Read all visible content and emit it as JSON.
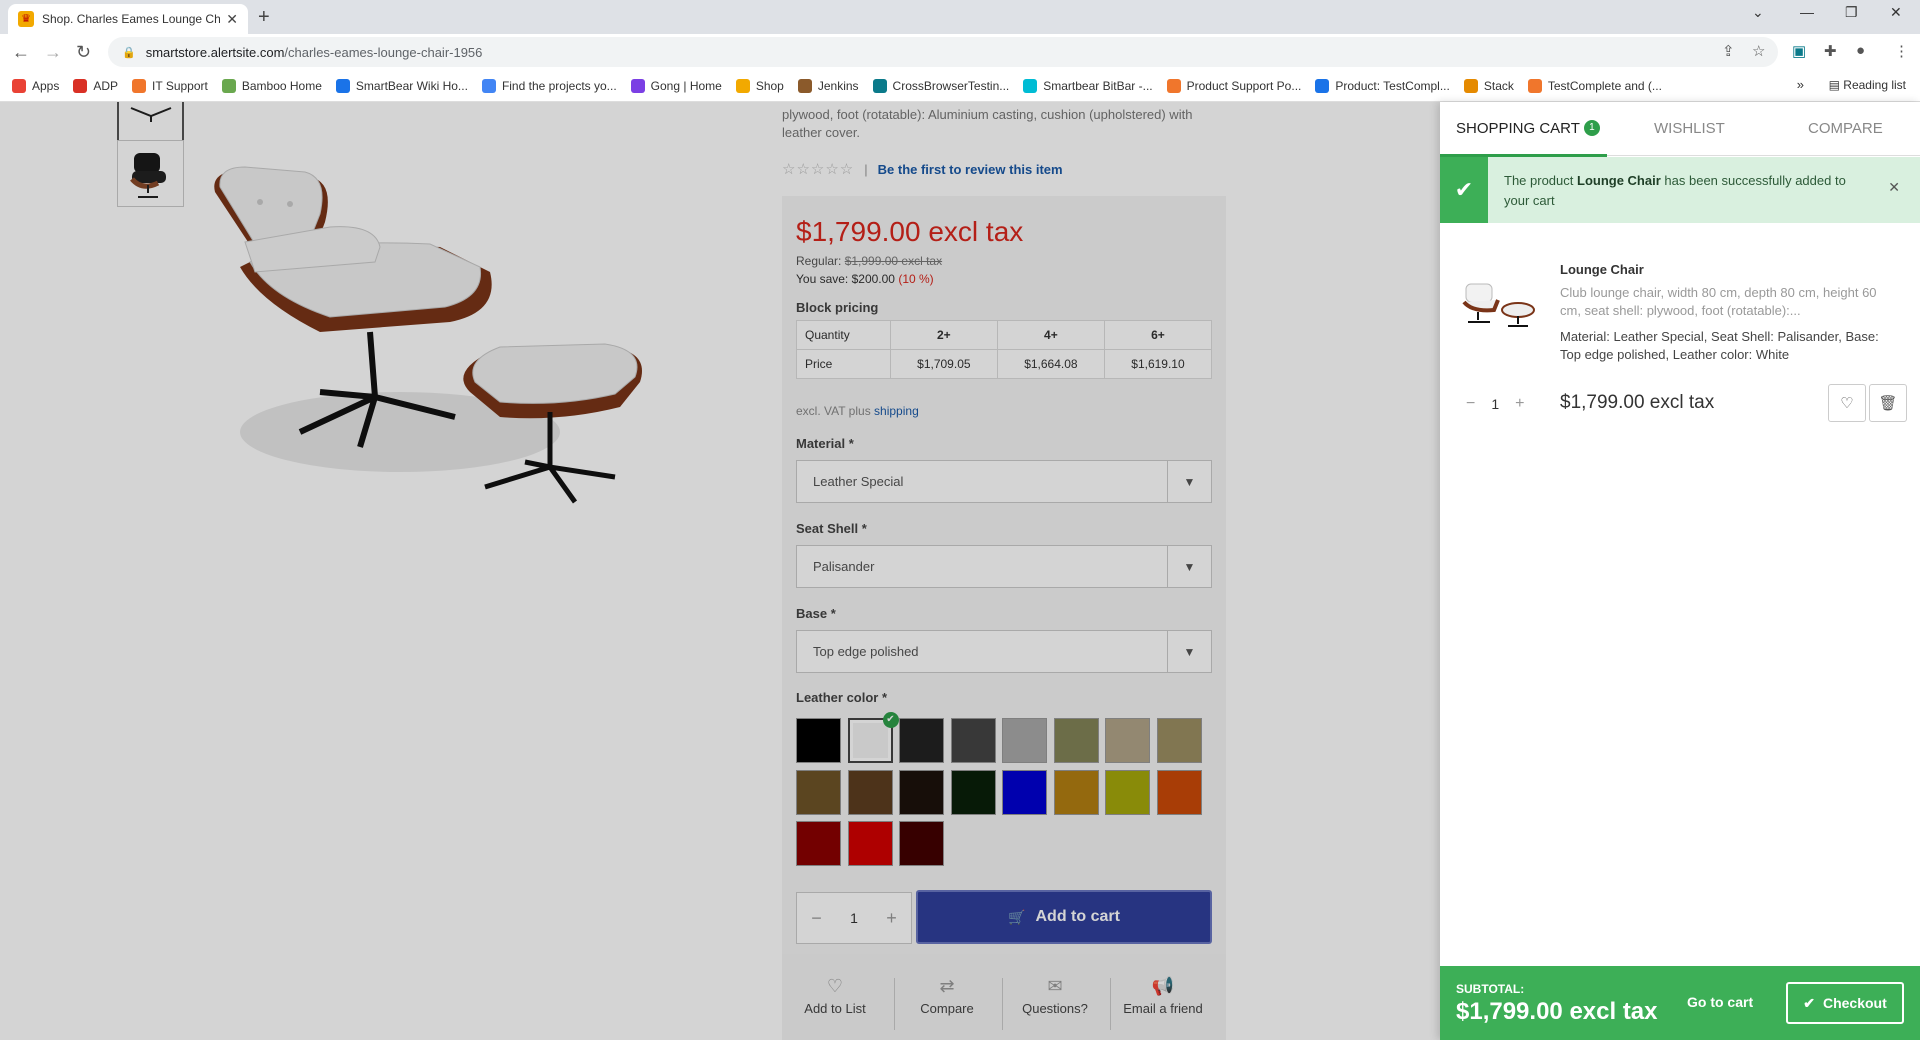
{
  "browser": {
    "tab_title": "Shop. Charles Eames Lounge Chair",
    "url_host": "smartstore.alertsite.com",
    "url_path": "/charles-eames-lounge-chair-1956",
    "bookmarks": [
      "Apps",
      "ADP",
      "IT Support",
      "Bamboo Home",
      "SmartBear Wiki Ho...",
      "Find the projects yo...",
      "Gong | Home",
      "Shop",
      "Jenkins",
      "CrossBrowserTestin...",
      "Smartbear BitBar -...",
      "Product Support Po...",
      "Product: TestCompl...",
      "Stack",
      "TestComplete and (..."
    ],
    "bookmark_colors": [
      "#e94235",
      "#d93025",
      "#f0762c",
      "#6aa84f",
      "#1a73e8",
      "#4285f4",
      "#7b3fe4",
      "#f2a900",
      "#8b5a2b",
      "#0b7a8a",
      "#00bcd4",
      "#f0762c",
      "#1a73e8",
      "#e58a00",
      "#f0762c"
    ],
    "reading_list": "Reading list",
    "more": "»"
  },
  "product": {
    "description": "plywood, foot (rotatable): Aluminium casting, cushion (upholstered) with leather cover.",
    "stars": "☆☆☆☆☆",
    "review_link": "Be the first to review this item",
    "price": "$1,799.00 excl tax",
    "regular_label": "Regular:",
    "regular_price": "$1,999.00 excl tax",
    "save_label": "You save: $200.00",
    "save_pct": "(10 %)",
    "block_pricing_label": "Block pricing",
    "tier_header": [
      "Quantity",
      "2+",
      "4+",
      "6+"
    ],
    "tier_prices": [
      "Price",
      "$1,709.05",
      "$1,664.08",
      "$1,619.10"
    ],
    "vat_text": "excl. VAT plus",
    "shipping_link": "shipping",
    "material_label": "Material *",
    "material_value": "Leather Special",
    "seatshell_label": "Seat Shell *",
    "seatshell_value": "Palisander",
    "base_label": "Base *",
    "base_value": "Top edge polished",
    "leather_label": "Leather color *",
    "swatches": [
      "#000000",
      "#f2f2f2",
      "#222222",
      "#444444",
      "#a9a9a9",
      "#828457",
      "#b1a488",
      "#9c8f62",
      "#6e5327",
      "#5d3e20",
      "#1c110c",
      "#092009",
      "#0000d2",
      "#b37f12",
      "#a5a80b",
      "#cb4a08",
      "#8b0000",
      "#d20000",
      "#430000"
    ],
    "qty": "1",
    "add_to_cart": "Add to cart",
    "actions": [
      "Add to List",
      "Compare",
      "Questions?",
      "Email a friend"
    ]
  },
  "cart": {
    "tab_cart": "SHOPPING CART",
    "badge": "1",
    "tab_wishlist": "WISHLIST",
    "tab_compare": "COMPARE",
    "notice_pre": "The product",
    "notice_product": "Lounge Chair",
    "notice_post": "has been successfully added to your cart",
    "item_name": "Lounge Chair",
    "item_desc": "Club lounge chair, width 80 cm, depth 80 cm, height 60 cm, seat shell: plywood, foot (rotatable):...",
    "item_attrs": "Material: Leather Special, Seat Shell: Palisander, Base: Top edge polished, Leather color: White",
    "item_qty": "1",
    "item_price": "$1,799.00 excl tax",
    "subtotal_label": "SUBTOTAL:",
    "subtotal": "$1,799.00 excl tax",
    "go_to_cart": "Go to cart",
    "checkout": "Checkout"
  }
}
